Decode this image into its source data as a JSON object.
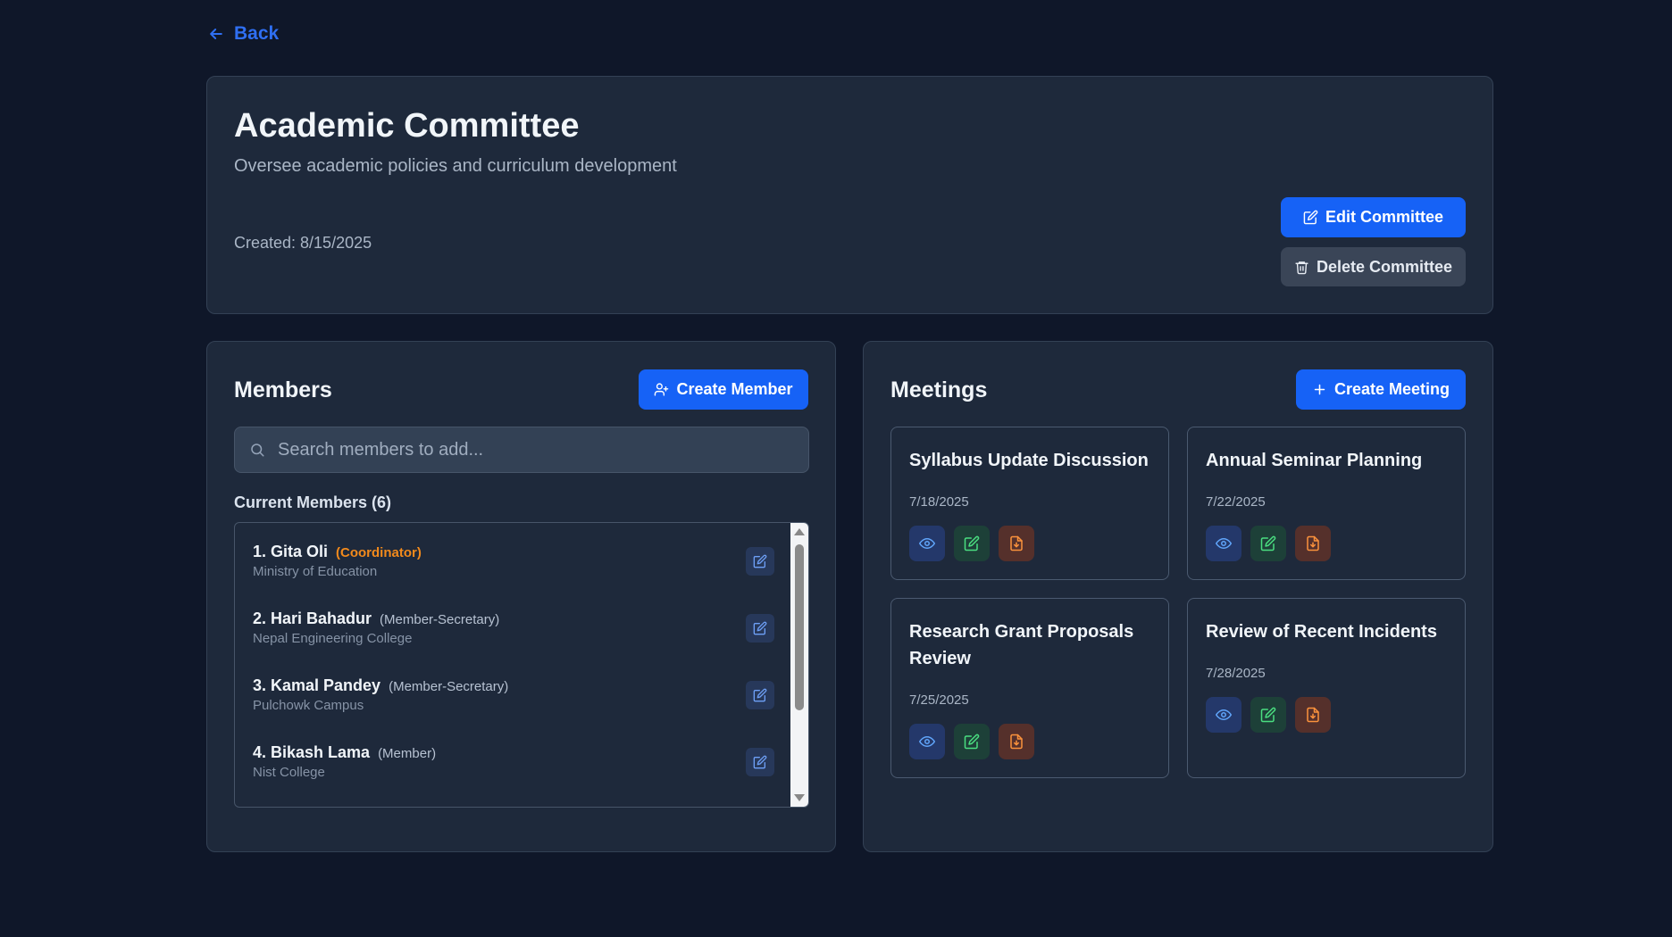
{
  "nav": {
    "back_label": "Back"
  },
  "committee": {
    "title": "Academic Committee",
    "description": "Oversee academic policies and curriculum development",
    "created": "Created: 8/15/2025",
    "edit_label": "Edit Committee",
    "delete_label": "Delete Committee"
  },
  "members": {
    "title": "Members",
    "create_label": "Create Member",
    "search_placeholder": "Search members to add...",
    "current_label": "Current Members (6)",
    "items": [
      {
        "name": "1. Gita Oli",
        "role": "(Coordinator)",
        "org": "Ministry of Education"
      },
      {
        "name": "2. Hari Bahadur",
        "role": "(Member-Secretary)",
        "org": "Nepal Engineering College"
      },
      {
        "name": "3. Kamal Pandey",
        "role": "(Member-Secretary)",
        "org": "Pulchowk Campus"
      },
      {
        "name": "4. Bikash Lama",
        "role": "(Member)",
        "org": "Nist College"
      }
    ]
  },
  "meetings": {
    "title": "Meetings",
    "create_label": "Create Meeting",
    "items": [
      {
        "title": "Syllabus Update Discussion",
        "date": "7/18/2025"
      },
      {
        "title": "Annual Seminar Planning",
        "date": "7/22/2025"
      },
      {
        "title": "Research Grant Proposals Review",
        "date": "7/25/2025"
      },
      {
        "title": "Review of Recent Incidents",
        "date": "7/28/2025"
      }
    ]
  },
  "colors": {
    "background": "#0f1729",
    "card": "#1e293b",
    "primary": "#1662f6",
    "link": "#2f6ff2",
    "coordinator": "#f28a1c",
    "view_icon": "#60a5fa",
    "edit_icon": "#4ade80",
    "pdf_icon": "#fb923c"
  },
  "icons": {
    "back": "arrow-left-icon",
    "edit": "pencil-square-icon",
    "delete": "trash-icon",
    "add_member": "user-plus-icon",
    "add_meeting": "plus-icon",
    "search": "search-icon",
    "view": "eye-icon",
    "download": "file-download-icon"
  }
}
